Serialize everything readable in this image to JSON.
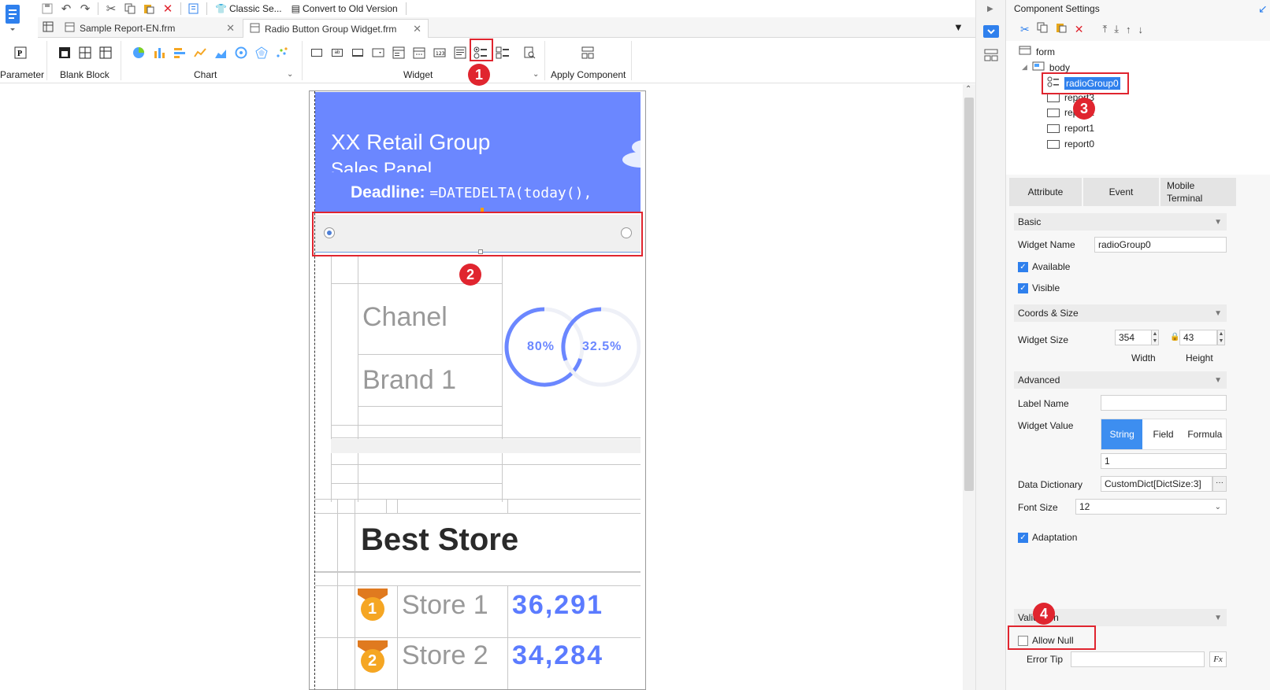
{
  "quickbar": {
    "classic_style": "Classic Se...",
    "convert_old": "Convert to Old Version"
  },
  "tabs": [
    {
      "label": "Sample Report-EN.frm"
    },
    {
      "label": "Radio Button Group Widget.frm"
    }
  ],
  "ribbon": {
    "parameter": "Parameter",
    "blank_block": "Blank Block",
    "chart": "Chart",
    "widget": "Widget",
    "apply_component": "Apply Component"
  },
  "canvas": {
    "title_line1": "XX Retail Group",
    "title_line2": "Sales Panel",
    "deadline_label": "Deadline:",
    "deadline_formula": "=DATEDELTA(today(),",
    "brand_row1": "Chanel",
    "brand_row2": "Brand 1",
    "ring1_value": "80%",
    "ring2_value": "32.5%",
    "best_store": "Best Store",
    "stores": [
      {
        "rank": "1",
        "name": "Store 1",
        "value": "36,291"
      },
      {
        "rank": "2",
        "name": "Store 2",
        "value": "34,284"
      }
    ]
  },
  "markers": [
    "1",
    "2",
    "3",
    "4"
  ],
  "panel": {
    "title": "Component Settings",
    "tree": {
      "root": "form",
      "body": "body",
      "items": [
        "radioGroup0",
        "report3",
        "report2",
        "report1",
        "report0"
      ]
    },
    "tabs": [
      "Attribute",
      "Event",
      "Mobile Terminal"
    ],
    "sections": {
      "basic": "Basic",
      "coords": "Coords & Size",
      "advanced": "Advanced",
      "validation": "Validation"
    },
    "widget_name_label": "Widget Name",
    "widget_name_value": "radioGroup0",
    "available_label": "Available",
    "visible_label": "Visible",
    "widget_size_label": "Widget Size",
    "width_value": "354",
    "height_value": "43",
    "width_label": "Width",
    "height_label": "Height",
    "label_name_label": "Label Name",
    "label_name_value": "",
    "widget_value_label": "Widget Value",
    "value_modes": [
      "String",
      "Field",
      "Formula"
    ],
    "widget_value": "1",
    "data_dict_label": "Data Dictionary",
    "data_dict_value": "CustomDict[DictSize:3]",
    "font_size_label": "Font Size",
    "font_size_value": "12",
    "adaptation_label": "Adaptation",
    "allow_null_label": "Allow Null",
    "error_tip_label": "Error Tip"
  },
  "colors": {
    "accent_blue": "#6b87ff",
    "marker_red": "#e0252f",
    "checkbox_blue": "#2f80ed",
    "string_button": "#3d8ef0",
    "medal_orange": "#f5a623"
  }
}
